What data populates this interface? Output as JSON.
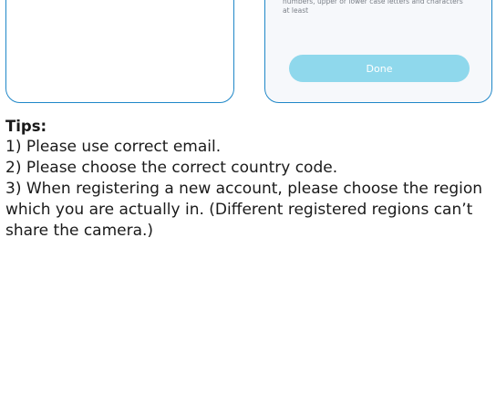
{
  "right_panel": {
    "password_hint": "numbers, upper or lower case letters and characters at least",
    "done_label": "Done"
  },
  "tips": {
    "title": "Tips:",
    "items": [
      "1) Please use correct email.",
      "2) Please choose the correct country code.",
      "3) When registering a new account, please choose the region which you are actually in. (Different registered regions can’t share the camera.)"
    ]
  },
  "colors": {
    "card_border": "#1f87c8",
    "done_button_bg": "#8fd8ec",
    "hint_text": "#7a7f87"
  }
}
